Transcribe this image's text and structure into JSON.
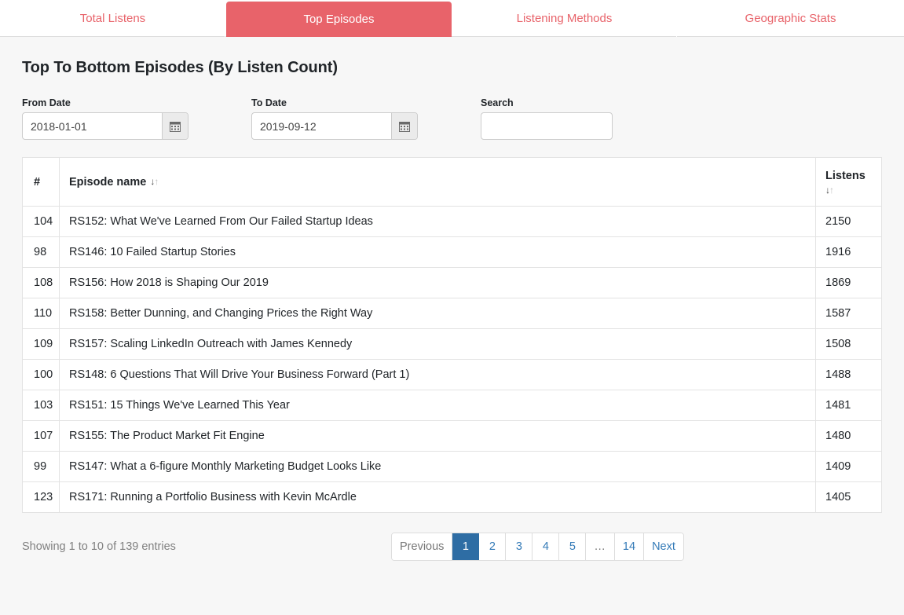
{
  "tabs": [
    {
      "label": "Total Listens",
      "active": false
    },
    {
      "label": "Top Episodes",
      "active": true
    },
    {
      "label": "Listening Methods",
      "active": false
    },
    {
      "label": "Geographic Stats",
      "active": false
    }
  ],
  "page": {
    "title": "Top To Bottom Episodes (By Listen Count)"
  },
  "filters": {
    "from": {
      "label": "From Date",
      "value": "2018-01-01",
      "placeholder": "",
      "icon": "calendar-icon"
    },
    "to": {
      "label": "To Date",
      "value": "2019-09-12",
      "placeholder": "",
      "icon": "calendar-icon"
    },
    "search": {
      "label": "Search",
      "value": "",
      "placeholder": ""
    }
  },
  "table": {
    "columns": [
      {
        "key": "num",
        "label": "#",
        "sortable": false
      },
      {
        "key": "name",
        "label": "Episode name",
        "sortable": true,
        "sort_icon": "sort-updown-icon"
      },
      {
        "key": "listens",
        "label": "Listens",
        "sortable": true,
        "sort_icon": "sort-updown-icon"
      }
    ],
    "rows": [
      {
        "num": "104",
        "name": "RS152: What We've Learned From Our Failed Startup Ideas",
        "listens": "2150"
      },
      {
        "num": "98",
        "name": "RS146: 10 Failed Startup Stories",
        "listens": "1916"
      },
      {
        "num": "108",
        "name": "RS156: How 2018 is Shaping Our 2019",
        "listens": "1869"
      },
      {
        "num": "110",
        "name": "RS158: Better Dunning, and Changing Prices the Right Way",
        "listens": "1587"
      },
      {
        "num": "109",
        "name": "RS157: Scaling LinkedIn Outreach with James Kennedy",
        "listens": "1508"
      },
      {
        "num": "100",
        "name": "RS148: 6 Questions That Will Drive Your Business Forward (Part 1)",
        "listens": "1488"
      },
      {
        "num": "103",
        "name": "RS151: 15 Things We've Learned This Year",
        "listens": "1481"
      },
      {
        "num": "107",
        "name": "RS155: The Product Market Fit Engine",
        "listens": "1480"
      },
      {
        "num": "99",
        "name": "RS147: What a 6-figure Monthly Marketing Budget Looks Like",
        "listens": "1409"
      },
      {
        "num": "123",
        "name": "RS171: Running a Portfolio Business with Kevin McArdle",
        "listens": "1405"
      }
    ]
  },
  "footer": {
    "showing": "Showing 1 to 10 of 139 entries",
    "pagination": [
      {
        "label": "Previous",
        "type": "prev",
        "active": false
      },
      {
        "label": "1",
        "type": "page",
        "active": true
      },
      {
        "label": "2",
        "type": "page",
        "active": false
      },
      {
        "label": "3",
        "type": "page",
        "active": false
      },
      {
        "label": "4",
        "type": "page",
        "active": false
      },
      {
        "label": "5",
        "type": "page",
        "active": false
      },
      {
        "label": "…",
        "type": "ellipsis",
        "active": false
      },
      {
        "label": "14",
        "type": "page",
        "active": false
      },
      {
        "label": "Next",
        "type": "next",
        "active": false
      }
    ]
  },
  "colors": {
    "accent_red": "#e8636a",
    "pagination_active": "#2e6da4",
    "link_blue": "#337ab7",
    "page_bg": "#f7f7f7",
    "muted_text": "#808080"
  }
}
